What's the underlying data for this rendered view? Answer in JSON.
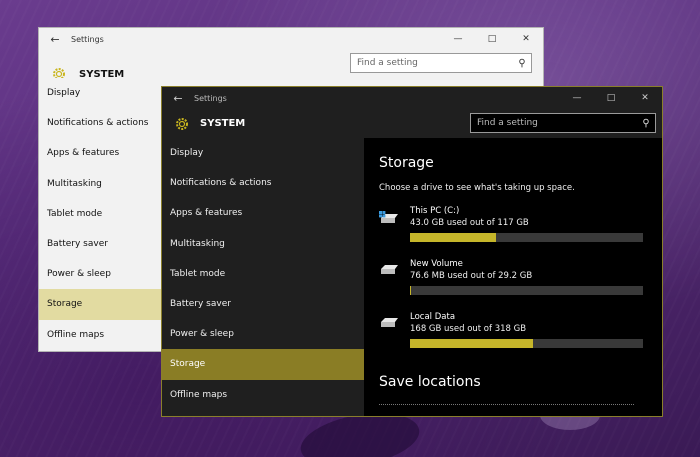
{
  "icons": {
    "back": "back-arrow-icon",
    "settings": "gear-icon",
    "search": "search-icon",
    "drive_system": "windows-drive-icon",
    "drive": "hard-drive-icon"
  },
  "colors": {
    "accent_light_selection": "#e2dba1",
    "accent_dark_selection": "#8a7d25",
    "usage_bar_fill": "#c5b52a"
  },
  "light_window": {
    "title": "Settings",
    "section": "SYSTEM",
    "search_placeholder": "Find a setting",
    "nav": [
      "Display",
      "Notifications & actions",
      "Apps & features",
      "Multitasking",
      "Tablet mode",
      "Battery saver",
      "Power & sleep",
      "Storage",
      "Offline maps"
    ],
    "selected_index": 7
  },
  "dark_window": {
    "title": "Settings",
    "section": "SYSTEM",
    "search_placeholder": "Find a setting",
    "nav": [
      "Display",
      "Notifications & actions",
      "Apps & features",
      "Multitasking",
      "Tablet mode",
      "Battery saver",
      "Power & sleep",
      "Storage",
      "Offline maps"
    ],
    "selected_index": 7,
    "content": {
      "heading": "Storage",
      "description": "Choose a drive to see what's taking up space.",
      "drives": [
        {
          "name": "This PC (C:)",
          "usage": "43.0 GB used out of 117 GB",
          "fraction": 0.367
        },
        {
          "name": "New Volume",
          "usage": "76.6 MB used out of 29.2 GB",
          "fraction": 0.003
        },
        {
          "name": "Local Data",
          "usage": "168 GB used out of 318 GB",
          "fraction": 0.528
        }
      ],
      "save_heading": "Save locations"
    }
  }
}
